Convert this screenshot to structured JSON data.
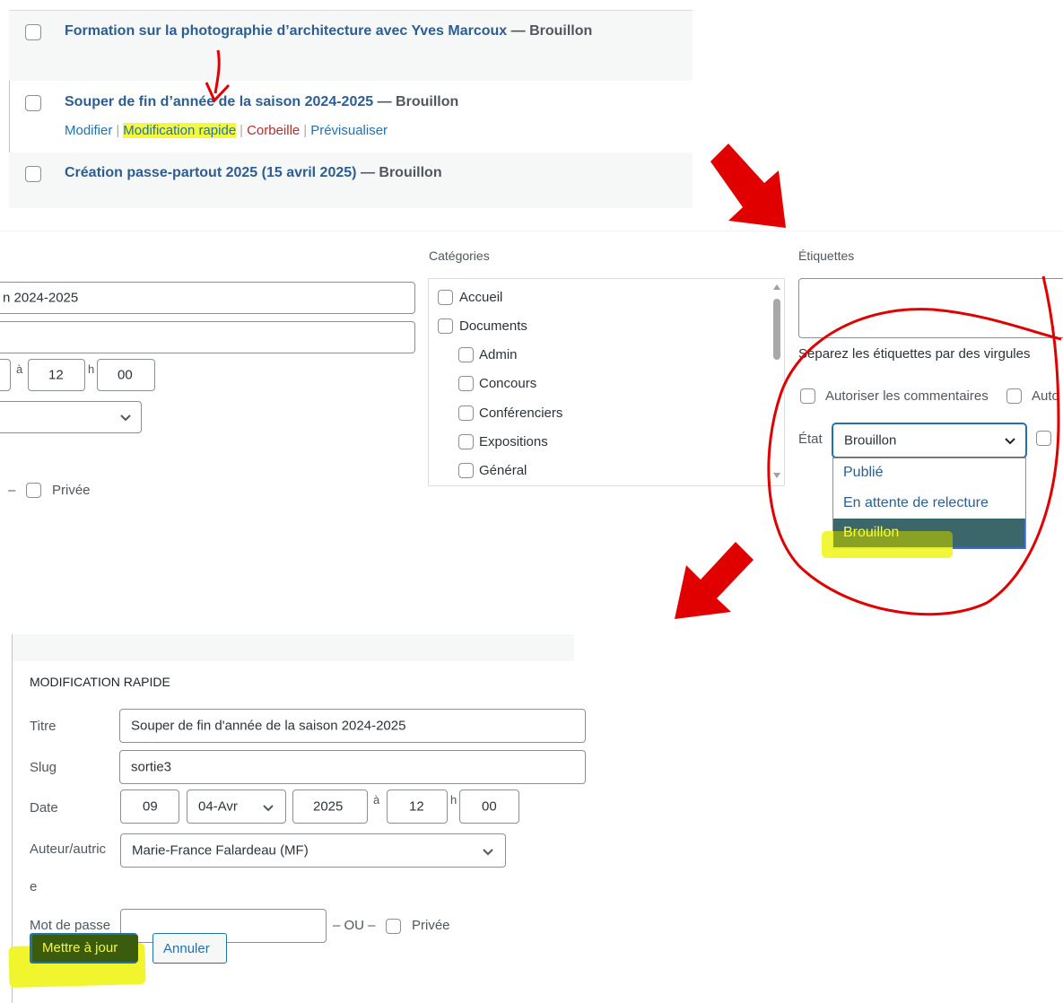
{
  "post_list": {
    "rows": [
      {
        "title": "Formation sur la photographie d’architecture avec Yves Marcoux",
        "state": "— Brouillon"
      },
      {
        "title": "Souper de fin d’année de la saison 2024-2025",
        "state": "— Brouillon"
      },
      {
        "title": "Création passe-partout 2025 (15 avril 2025)",
        "state": "— Brouillon"
      }
    ],
    "row_actions": {
      "edit": "Modifier",
      "quick_edit": "Modification rapide",
      "trash": "Corbeille",
      "preview": "Prévisualiser",
      "separator": "|"
    }
  },
  "middle": {
    "title_value": "n 2024-2025",
    "time_sep": "à",
    "hour": "12",
    "hour_sep": "h",
    "minute": "00",
    "private_dash": "–",
    "private_label": "Privée",
    "categories_label": "Catégories",
    "categories": [
      "Accueil",
      "Documents",
      "Admin",
      "Concours",
      "Conférenciers",
      "Expositions",
      "Général"
    ],
    "tags_label": "Étiquettes",
    "tags_hint": "Séparez les étiquettes par des virgules",
    "allow_comments": "Autoriser les commentaires",
    "allow_pings_partial": "Auto",
    "status_label": "État",
    "status_value": "Brouillon",
    "status_options": [
      "Publié",
      "En attente de relecture",
      "Brouillon"
    ]
  },
  "quick_edit": {
    "heading": "MODIFICATION RAPIDE",
    "title_label": "Titre",
    "title_value": "Souper de fin d'année de la saison 2024-2025",
    "slug_label": "Slug",
    "slug_value": "sortie3",
    "date_label": "Date",
    "day": "09",
    "month": "04-Avr",
    "year": "2025",
    "time_sep": "à",
    "hour": "12",
    "hour_sep": "h",
    "minute": "00",
    "author_label_1": "Auteur/autric",
    "author_label_2": "e",
    "author_value": "Marie-France Falardeau (MF)",
    "password_label": "Mot de passe",
    "password_value": "",
    "or_label": "– OU –",
    "private_label": "Privée",
    "update_button": "Mettre à jour",
    "cancel_button": "Annuler"
  },
  "colors": {
    "link": "#2c5e93",
    "highlight": "#f6f93a",
    "annotation_red": "#e00000",
    "selected_option": "#3b6cd4",
    "primary_button": "#2271b1"
  },
  "icons": [
    "chevron-down-icon",
    "scrollbar",
    "red-arrow-icon"
  ]
}
